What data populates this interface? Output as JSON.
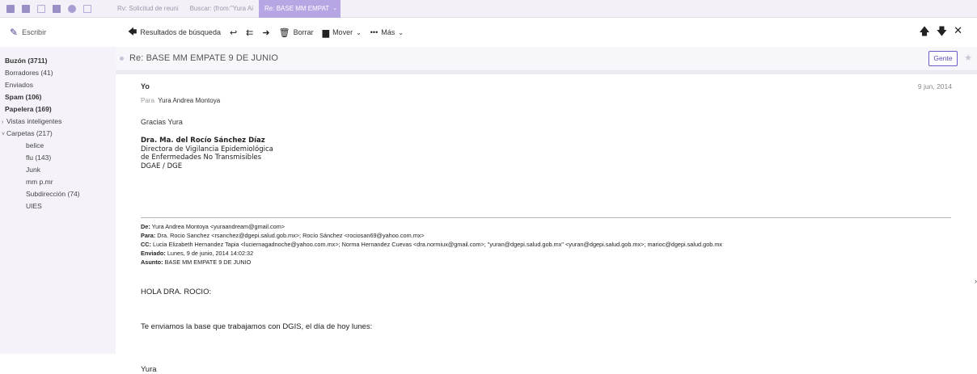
{
  "tabs": {
    "items": [
      "Rv: Solicitud de reuni",
      "Buscar: (from:\"Yura Ai",
      "Re: BASE MM EMPAT"
    ],
    "active_index": 2,
    "chevron": "⌄"
  },
  "toolbar": {
    "compose_label": "Escribir",
    "back_label": "Resultados de búsqueda",
    "delete_label": "Borrar",
    "move_label": "Mover",
    "more_label": "Más"
  },
  "sidebar": {
    "items": [
      {
        "label": "Buzón (3711)",
        "bold": true
      },
      {
        "label": "Borradores (41)",
        "bold": false
      },
      {
        "label": "Enviados",
        "bold": false
      },
      {
        "label": "Spam (106)",
        "bold": true
      },
      {
        "label": "Papelera (169)",
        "bold": true
      },
      {
        "label": "Vistas inteligentes",
        "bold": false
      },
      {
        "label": "Carpetas (217)",
        "bold": false
      },
      {
        "label": "belice",
        "bold": false
      },
      {
        "label": "flu (143)",
        "bold": false
      },
      {
        "label": "Junk",
        "bold": false
      },
      {
        "label": "mm p.mr",
        "bold": false
      },
      {
        "label": "Subdirección (74)",
        "bold": false
      },
      {
        "label": "UIES",
        "bold": false
      }
    ]
  },
  "message": {
    "subject": "Re: BASE MM EMPATE 9 DE JUNIO",
    "people_button": "Gente",
    "from": "Yo",
    "date": "9 jun, 2014",
    "to_prefix": "Para",
    "to_name": "Yura Andrea Montoya",
    "greeting": "Gracias Yura",
    "signature": {
      "name": "Dra. Ma. del Rocío Sánchez Díaz",
      "line1": "Directora de Vigilancia Epidemiológica",
      "line2": "de Enfermedades No Transmisibles",
      "line3": "DGAE / DGE"
    },
    "forwarded": {
      "de_label": "De:",
      "de_value": "Yura Andrea Montoya <yuraandream@gmail.com>",
      "para_label": "Para:",
      "para_value": "Dra. Rocio Sanchez <rsanchez@dgepi.salud.gob.mx>; Rocío Sánchez <rociosan69@yahoo.com.mx>",
      "cc_label": "CC:",
      "cc_value": "Lucia Elizabeth Hernandez Tapia <luciernagadnoche@yahoo.com.mx>; Norma Hernandez Cuevas <dra.normiux@gmail.com>; \"yuran@dgepi.salud.gob.mx\" <yuran@dgepi.salud.gob.mx>; marioc@dgepi.salud.gob.mx",
      "enviado_label": "Enviado:",
      "enviado_value": "Lunes, 9 de junio, 2014 14:02:32",
      "asunto_label": "Asunto:",
      "asunto_value": "BASE MM EMPATE 9 DE JUNIO"
    },
    "body": {
      "salutation": "HOLA DRA. ROCIO:",
      "text": "Te  enviamos la base que  trabajamos con DGIS, el día de hoy lunes:",
      "closing": "Yura"
    }
  }
}
